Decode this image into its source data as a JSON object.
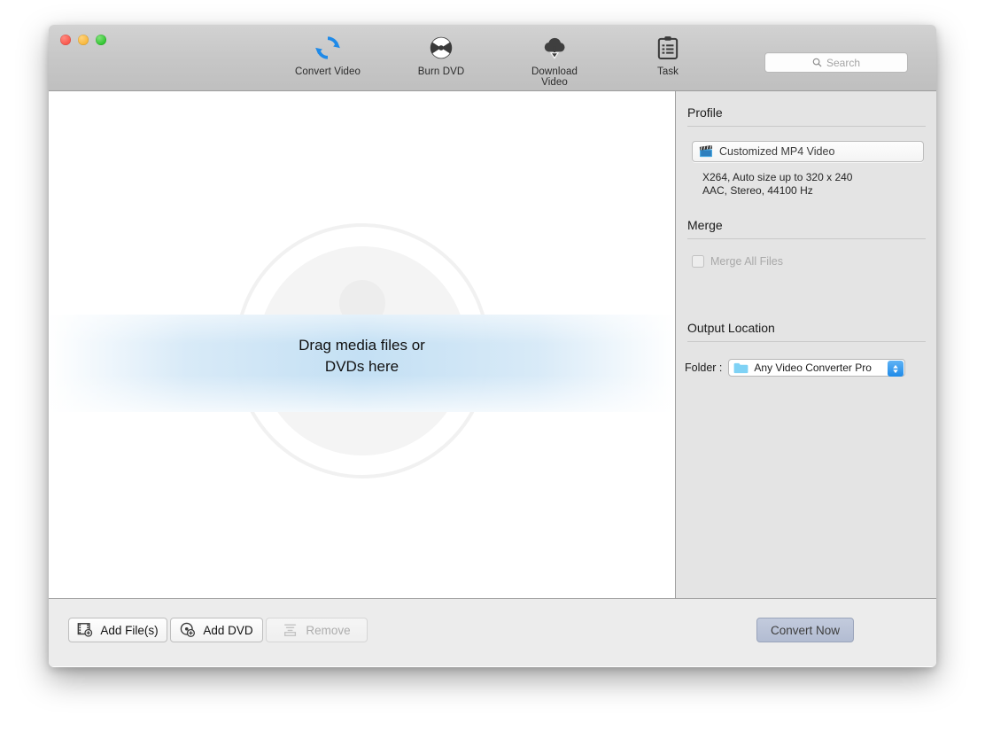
{
  "window": {
    "traffic_lights": [
      "close",
      "minimize",
      "zoom"
    ]
  },
  "toolbar": {
    "items": [
      {
        "label": "Convert Video",
        "icon": "convert-refresh-icon"
      },
      {
        "label": "Burn DVD",
        "icon": "dvd-disc-icon"
      },
      {
        "label": "Download Video",
        "icon": "cloud-download-icon"
      },
      {
        "label": "Task",
        "icon": "clipboard-task-icon"
      }
    ],
    "search": {
      "placeholder": "Search",
      "icon": "search-icon",
      "value": ""
    }
  },
  "drop_zone": {
    "line1": "Drag media files or",
    "line2": "DVDs here",
    "watermark_icon": "film-reel-watermark"
  },
  "sidebar": {
    "profile": {
      "title": "Profile",
      "selected": "Customized MP4 Video",
      "icon": "clapperboard-icon",
      "detail_line1": "X264, Auto size up to 320 x 240",
      "detail_line2": "AAC, Stereo, 44100 Hz"
    },
    "merge": {
      "title": "Merge",
      "checkbox_label": "Merge All Files",
      "checked": false,
      "disabled": true
    },
    "output": {
      "title": "Output Location",
      "folder_caption": "Folder :",
      "folder_value": "Any Video Converter Pro",
      "folder_icon": "folder-icon",
      "stepper_icon": "up-down-chevron-icon"
    }
  },
  "bottom_bar": {
    "add_files": {
      "label": "Add File(s)",
      "icon": "add-file-icon"
    },
    "add_dvd": {
      "label": "Add DVD",
      "icon": "add-dvd-icon"
    },
    "remove": {
      "label": "Remove",
      "icon": "remove-list-icon",
      "disabled": true
    },
    "convert": {
      "label": "Convert Now"
    }
  },
  "colors": {
    "accent_blue": "#1f8ae8",
    "toolbar_gray": "#c8c8c8",
    "sidebar_gray": "#e4e4e4",
    "bottom_gray": "#ececec",
    "convert_button": "#b2bcd2"
  }
}
